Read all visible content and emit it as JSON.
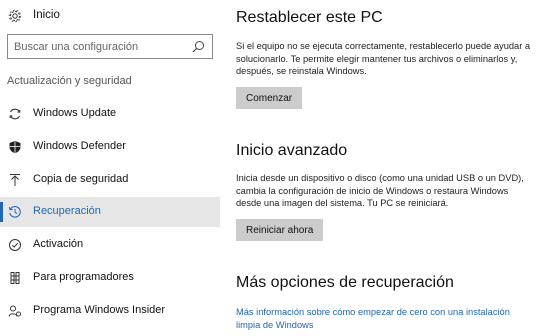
{
  "sidebar": {
    "home": {
      "label": "Inicio",
      "icon": "gear-icon"
    },
    "search": {
      "placeholder": "Buscar una configuración",
      "value": "",
      "icon": "search-icon"
    },
    "section_title": "Actualización y seguridad",
    "items": [
      {
        "label": "Windows Update",
        "icon": "refresh-icon",
        "active": false
      },
      {
        "label": "Windows Defender",
        "icon": "shield-icon",
        "active": false
      },
      {
        "label": "Copia de seguridad",
        "icon": "upload-icon",
        "active": false
      },
      {
        "label": "Recuperación",
        "icon": "history-icon",
        "active": true
      },
      {
        "label": "Activación",
        "icon": "check-circle-icon",
        "active": false
      },
      {
        "label": "Para programadores",
        "icon": "developer-icon",
        "active": false
      },
      {
        "label": "Programa Windows Insider",
        "icon": "insider-icon",
        "active": false
      }
    ]
  },
  "main": {
    "reset": {
      "title": "Restablecer este PC",
      "description": "Si el equipo no se ejecuta correctamente, restablecerlo puede ayudar a solucionarlo. Te permite elegir mantener tus archivos o eliminarlos y, después, se reinstala Windows.",
      "button": "Comenzar"
    },
    "advanced": {
      "title": "Inicio avanzado",
      "description": "Inicia desde un dispositivo o disco (como una unidad USB o un DVD), cambia la configuración de inicio de Windows o restaura Windows desde una imagen del sistema. Tu PC se reiniciará.",
      "button": "Reiniciar ahora"
    },
    "more": {
      "title": "Más opciones de recuperación",
      "link": "Más información sobre cómo empezar de cero con una instalación limpia de Windows"
    }
  },
  "colors": {
    "accent": "#1f67b1",
    "active_bg": "#e6e6e6",
    "button_bg": "#cccccc"
  }
}
